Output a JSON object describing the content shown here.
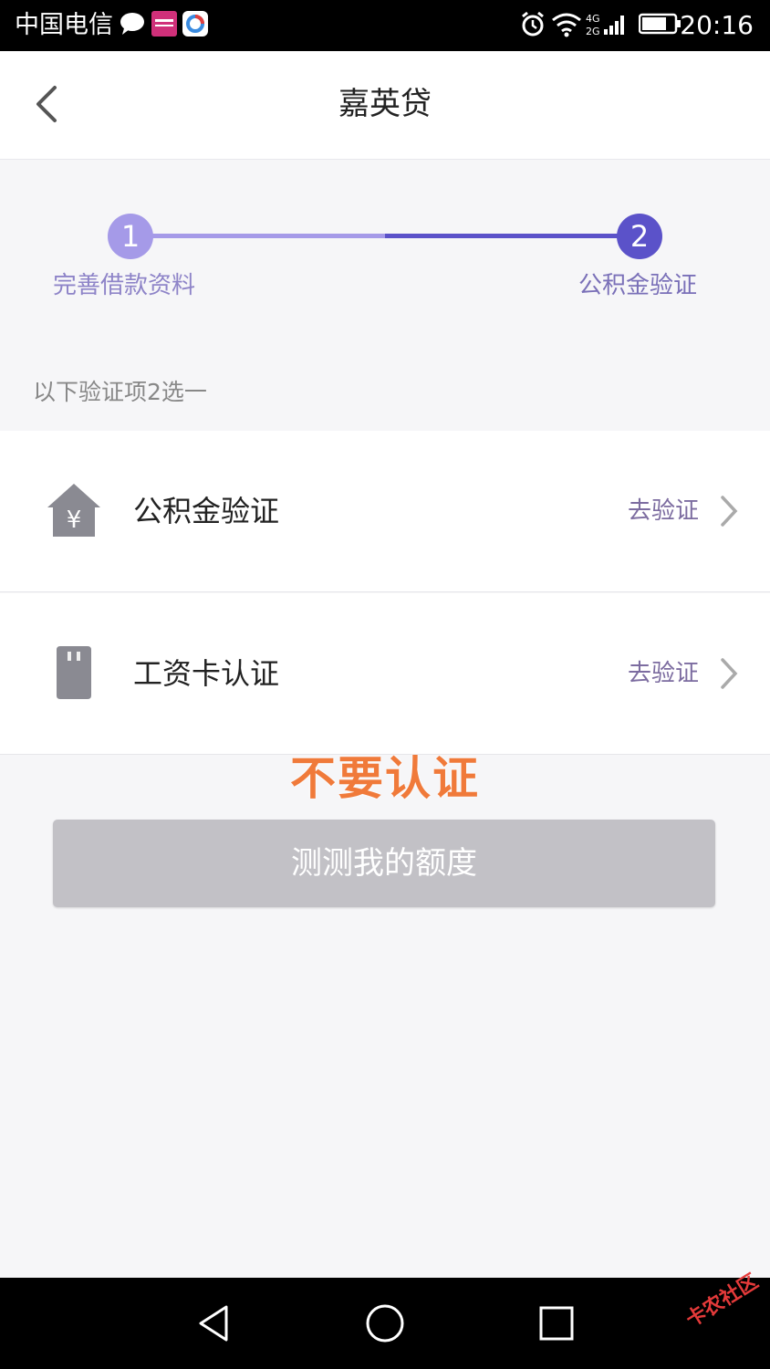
{
  "status_bar": {
    "carrier": "中国电信",
    "time": "20:16",
    "network": "4G 2G"
  },
  "nav": {
    "title": "嘉英贷"
  },
  "steps": [
    {
      "number": "1",
      "label": "完善借款资料",
      "color": "#a59ae8"
    },
    {
      "number": "2",
      "label": "公积金验证",
      "color": "#5b52c9"
    }
  ],
  "hint": "以下验证项2选一",
  "options": [
    {
      "title": "公积金验证",
      "action": "去验证",
      "icon": "house-yen-icon"
    },
    {
      "title": "工资卡认证",
      "action": "去验证",
      "icon": "sim-card-icon"
    }
  ],
  "annotation": "不要认证",
  "primary_button": "测测我的额度",
  "watermark": "卡农社区",
  "colors": {
    "accent_light": "#a59ae8",
    "accent_dark": "#5b52c9",
    "action_text": "#7c6ca0",
    "annotation": "#f07a3a",
    "button_disabled": "#c2c1c6"
  }
}
